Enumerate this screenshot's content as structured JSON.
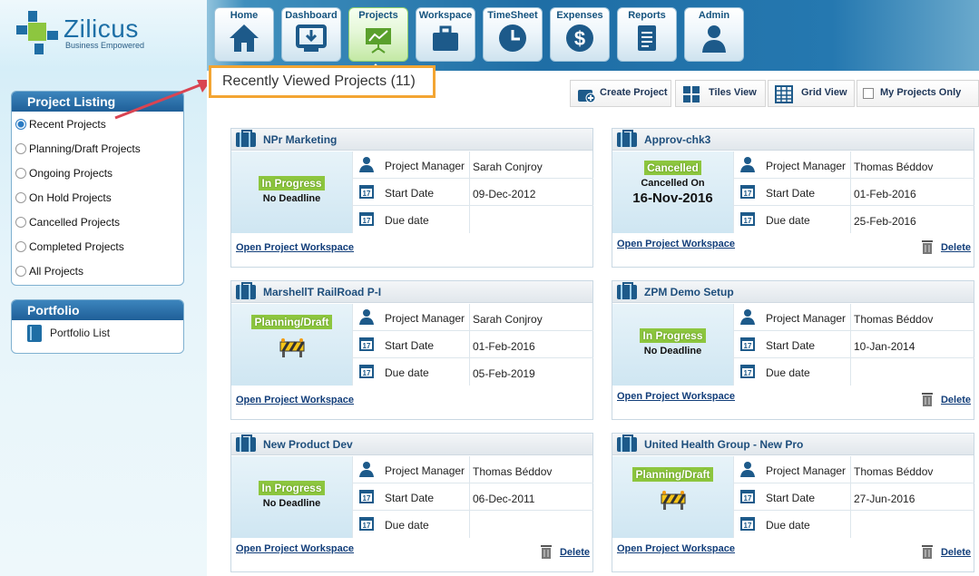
{
  "brand": {
    "name": "Zilicus",
    "tagline": "Business Empowered"
  },
  "nav": [
    {
      "label": "Home",
      "icon": "home-icon"
    },
    {
      "label": "Dashboard",
      "icon": "dashboard-icon"
    },
    {
      "label": "Projects",
      "icon": "projects-icon",
      "active": true
    },
    {
      "label": "Workspace",
      "icon": "workspace-icon"
    },
    {
      "label": "TimeSheet",
      "icon": "clock-icon"
    },
    {
      "label": "Expenses",
      "icon": "dollar-icon"
    },
    {
      "label": "Reports",
      "icon": "report-icon"
    },
    {
      "label": "Admin",
      "icon": "user-icon"
    }
  ],
  "sidebar": {
    "listing_title": "Project Listing",
    "listing_items": [
      {
        "label": "Recent Projects",
        "checked": true
      },
      {
        "label": "Planning/Draft Projects"
      },
      {
        "label": "Ongoing Projects"
      },
      {
        "label": "On Hold Projects"
      },
      {
        "label": "Cancelled Projects"
      },
      {
        "label": "Completed Projects"
      },
      {
        "label": "All Projects"
      }
    ],
    "portfolio_title": "Portfolio",
    "portfolio_items": [
      {
        "label": "Portfolio List"
      }
    ]
  },
  "main": {
    "title": "Recently Viewed Projects (11)",
    "toolbar": {
      "create": "Create Project",
      "tiles": "Tiles View",
      "grid": "Grid View",
      "mine": "My Projects Only"
    },
    "labels": {
      "manager": "Project Manager",
      "start": "Start Date",
      "due": "Due date",
      "open": "Open Project Workspace",
      "delete": "Delete"
    },
    "projects": [
      {
        "name": "NPr Marketing",
        "status": "In Progress",
        "status_sub": "No Deadline",
        "manager": "Sarah Conjroy",
        "start": "09-Dec-2012",
        "due": ""
      },
      {
        "name": "Approv-chk3",
        "status": "Cancelled",
        "status_sub": "Cancelled On",
        "status_date": "16-Nov-2016",
        "manager": "Thomas Béddov",
        "start": "01-Feb-2016",
        "due": "25-Feb-2016",
        "deletable": true
      },
      {
        "name": "MarshellT RailRoad P-I",
        "status": "Planning/Draft",
        "manager": "Sarah Conjroy",
        "start": "01-Feb-2016",
        "due": "05-Feb-2019"
      },
      {
        "name": "ZPM Demo Setup",
        "status": "In Progress",
        "status_sub": "No Deadline",
        "manager": "Thomas Béddov",
        "start": "10-Jan-2014",
        "due": "",
        "deletable": true
      },
      {
        "name": "New Product Dev",
        "status": "In Progress",
        "status_sub": "No Deadline",
        "manager": "Thomas Béddov",
        "start": "06-Dec-2011",
        "due": "",
        "deletable": true
      },
      {
        "name": "United Health Group - New Pro",
        "status": "Planning/Draft",
        "manager": "Thomas Béddov",
        "start": "27-Jun-2016",
        "due": "",
        "deletable": true
      }
    ]
  },
  "colors": {
    "accent": "#1f6ea5",
    "highlight": "#f3a533",
    "status_green": "#8dc63f",
    "arrow": "#d94452"
  }
}
